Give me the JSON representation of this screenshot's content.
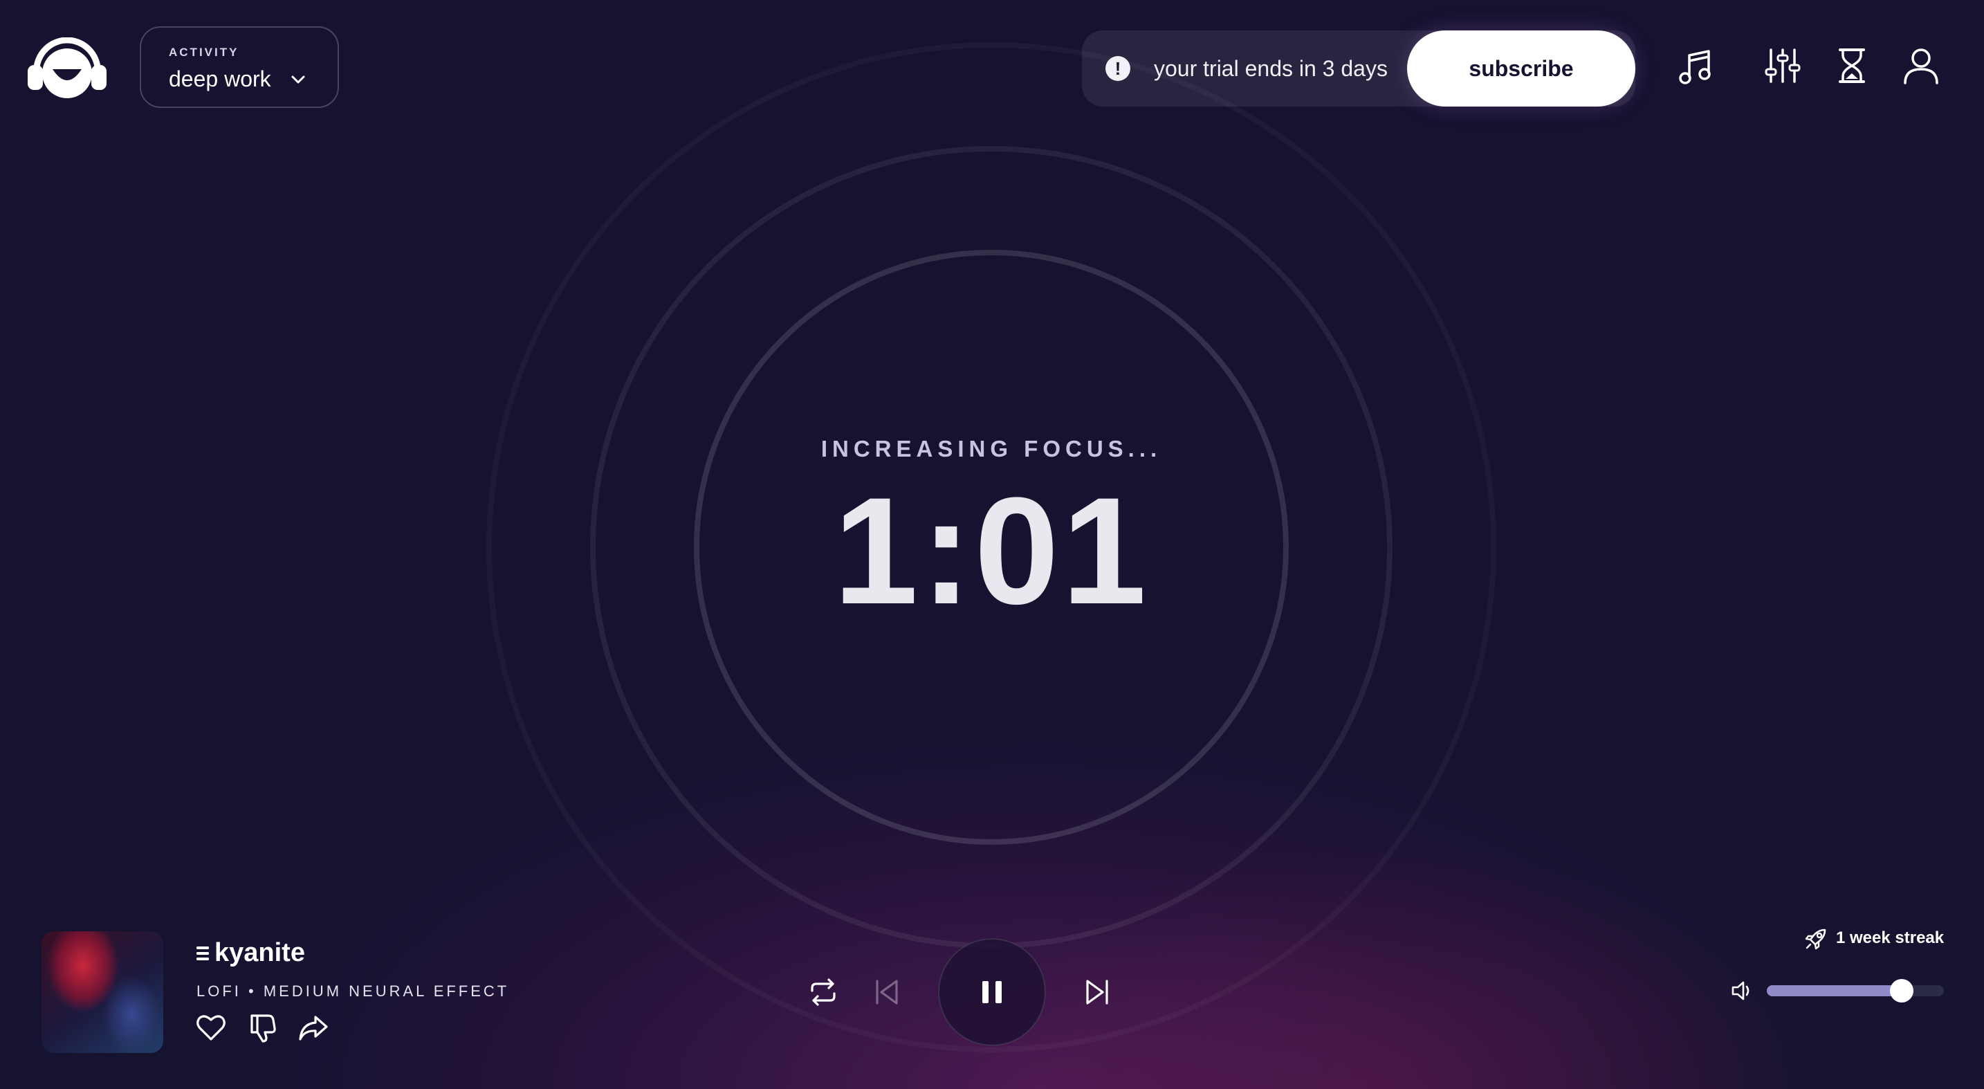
{
  "header": {
    "activity": {
      "label": "ACTIVITY",
      "value": "deep work"
    },
    "trial": {
      "message": "your trial ends in 3 days",
      "subscribe_label": "subscribe"
    },
    "nav_icons": [
      "music-note-icon",
      "sliders-icon",
      "hourglass-icon",
      "user-icon"
    ]
  },
  "timer": {
    "status": "INCREASING FOCUS...",
    "value": "1:01"
  },
  "player": {
    "track_title": "kyanite",
    "track_meta": "LOFI • MEDIUM NEURAL EFFECT",
    "streak": "1 week streak",
    "volume": 0.76
  },
  "colors": {
    "background": "#151330",
    "accent": "#8f8bc8",
    "ring": "#ffffff"
  }
}
